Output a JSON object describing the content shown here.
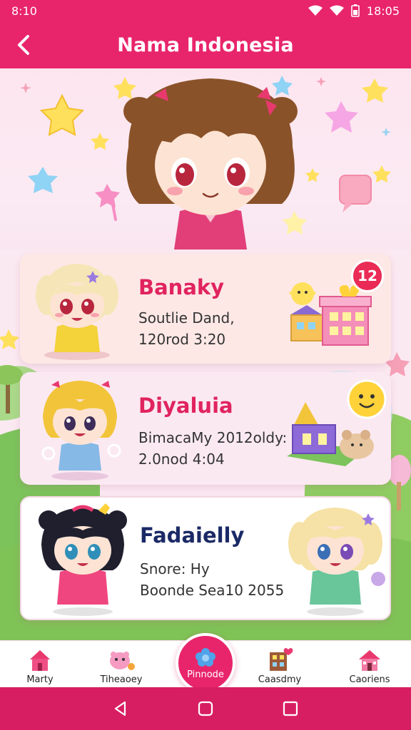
{
  "status_bar": {
    "time_left": "8:10",
    "time_right": "18:05"
  },
  "header": {
    "title": "Nama Indonesia"
  },
  "cards": [
    {
      "title": "Banaky",
      "line1": "Soutlie Dand,",
      "line2": "120rod 3:20",
      "badge": "12"
    },
    {
      "title": "Diyaluia",
      "line1": "BimacaMy 2012oldy:",
      "line2": "2.0nod 4:04"
    },
    {
      "title": "Fadaielly",
      "line1": "Snore: Hy",
      "line2": "Boonde Sea10 2055"
    }
  ],
  "bottom_nav": [
    {
      "label": "Marty",
      "icon": "house-icon"
    },
    {
      "label": "Tiheaoey",
      "icon": "pig-icon"
    },
    {
      "label": "Pinnode",
      "icon": "flower-icon"
    },
    {
      "label": "Caasdmy",
      "icon": "shop-icon"
    },
    {
      "label": "Caoriens",
      "icon": "cottage-icon"
    }
  ],
  "colors": {
    "primary": "#e8256b",
    "system_nav": "#d81e62",
    "card_title_pink": "#e0245f",
    "card_title_navy": "#1b2a66",
    "badge": "#ea2b55"
  }
}
